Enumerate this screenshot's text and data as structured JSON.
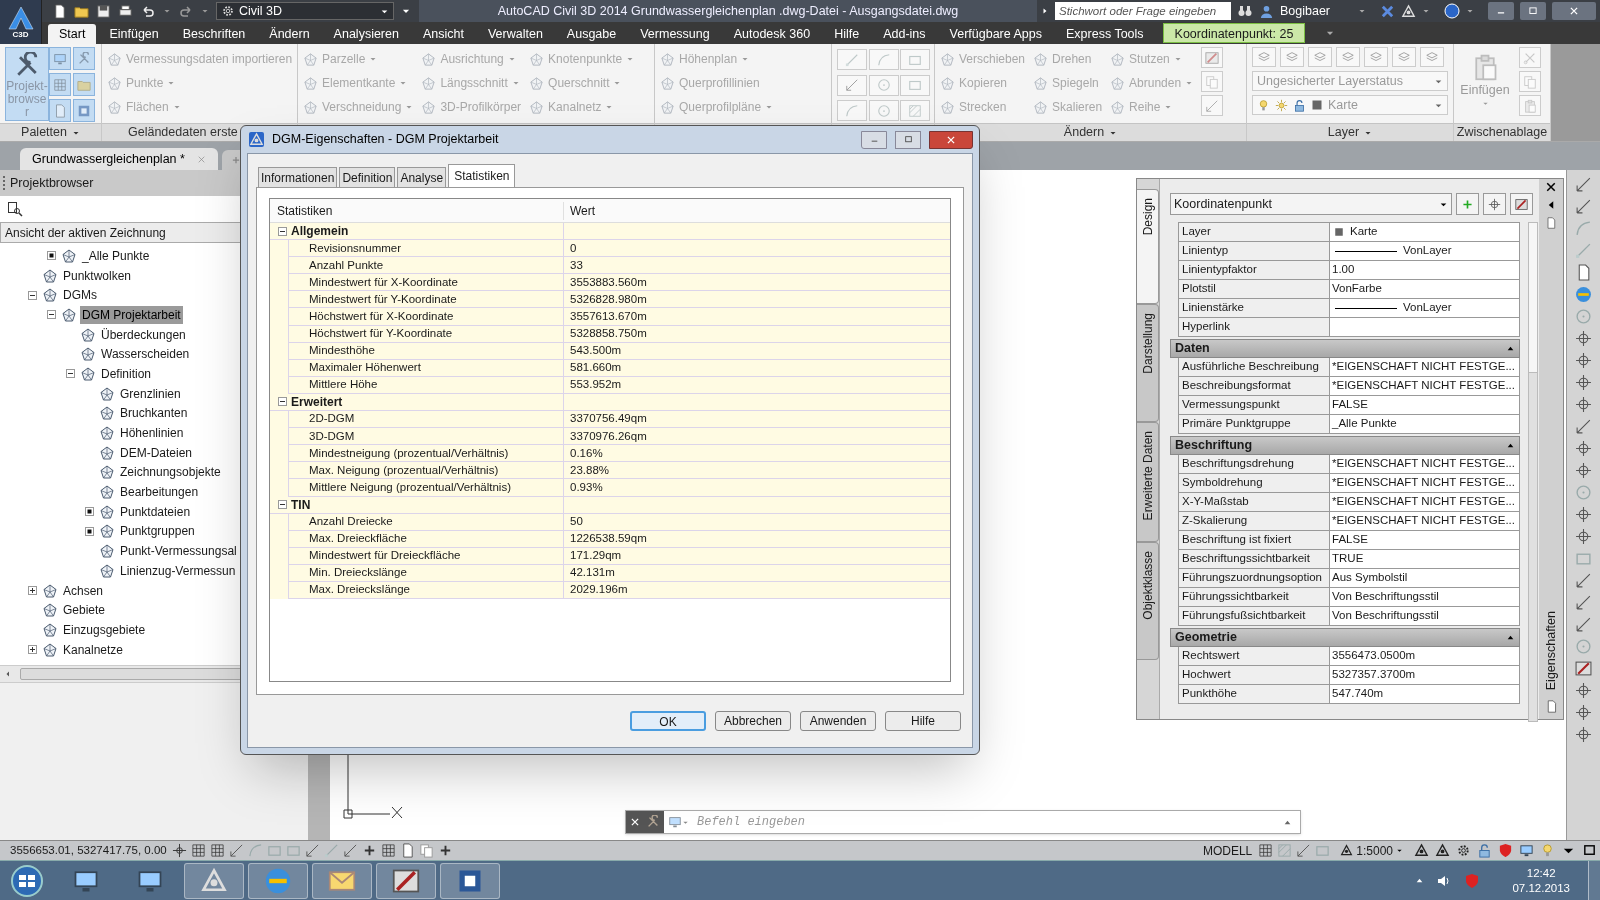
{
  "app_button": {
    "badge": "C3D"
  },
  "title_bar": {
    "workspace": "Civil 3D",
    "title": "AutoCAD Civil 3D 2014   Grundwassergleichenplan .dwg-Datei - Ausgangsdatei.dwg",
    "search_placeholder": "Stichwort oder Frage eingeben",
    "user": "Bogibaer"
  },
  "menu_tabs": [
    {
      "label": "Start",
      "selected": true,
      "kind": "tab"
    },
    {
      "label": "Einfügen",
      "selected": false,
      "kind": "tab"
    },
    {
      "label": "Beschriften",
      "selected": false,
      "kind": "tab"
    },
    {
      "label": "Ändern",
      "selected": false,
      "kind": "tab"
    },
    {
      "label": "Analysieren",
      "selected": false,
      "kind": "tab"
    },
    {
      "label": "Ansicht",
      "selected": false,
      "kind": "tab"
    },
    {
      "label": "Verwalten",
      "selected": false,
      "kind": "tab"
    },
    {
      "label": "Ausgabe",
      "selected": false,
      "kind": "tab"
    },
    {
      "label": "Vermessung",
      "selected": false,
      "kind": "tab"
    },
    {
      "label": "Autodesk 360",
      "selected": false,
      "kind": "tab"
    },
    {
      "label": "Hilfe",
      "selected": false,
      "kind": "tab"
    },
    {
      "label": "Add-ins",
      "selected": false,
      "kind": "tab"
    },
    {
      "label": "Verfügbare Apps",
      "selected": false,
      "kind": "tab"
    },
    {
      "label": "Express Tools",
      "selected": false,
      "kind": "tab"
    },
    {
      "label": "Koordinatenpunkt: 25",
      "selected": false,
      "kind": "contextual"
    }
  ],
  "ribbon": {
    "panels": [
      {
        "kind": "palettes",
        "label": "Paletten",
        "big_button": {
          "label": "Projekt-browser",
          "selected": true
        }
      },
      {
        "kind": "columns",
        "label": "Geländedaten erste",
        "columns": [
          [
            {
              "label": "Vermessungsdaten importieren",
              "dropdown": false,
              "disabled": true
            },
            {
              "label": "Punkte",
              "dropdown": true,
              "disabled": true
            },
            {
              "label": "Flächen",
              "dropdown": true,
              "disabled": true
            }
          ]
        ]
      },
      {
        "kind": "columns",
        "columns": [
          [
            {
              "label": "Parzelle",
              "dropdown": true,
              "disabled": true
            },
            {
              "label": "Elementkante",
              "dropdown": true,
              "disabled": true
            },
            {
              "label": "Verschneidung",
              "dropdown": true,
              "disabled": true
            }
          ],
          [
            {
              "label": "Ausrichtung",
              "dropdown": true,
              "disabled": true
            },
            {
              "label": "Längsschnitt",
              "dropdown": true,
              "disabled": true
            },
            {
              "label": "3D-Profilkörper",
              "dropdown": false,
              "disabled": true
            }
          ],
          [
            {
              "label": "Knotenpunkte",
              "dropdown": true,
              "disabled": true
            },
            {
              "label": "Querschnitt",
              "dropdown": true,
              "disabled": true
            },
            {
              "label": "Kanalnetz",
              "dropdown": true,
              "disabled": true
            }
          ]
        ]
      },
      {
        "kind": "columns",
        "columns": [
          [
            {
              "label": "Höhenplan",
              "dropdown": true,
              "disabled": true
            },
            {
              "label": "Querprofillinien",
              "dropdown": false,
              "disabled": true
            },
            {
              "label": "Querprofilpläne",
              "dropdown": true,
              "disabled": true
            }
          ]
        ]
      },
      {
        "kind": "draw"
      },
      {
        "kind": "columns",
        "label": "Ändern",
        "columns": [
          [
            {
              "label": "Verschieben",
              "dropdown": false,
              "disabled": true
            },
            {
              "label": "Kopieren",
              "dropdown": false,
              "disabled": true
            },
            {
              "label": "Strecken",
              "dropdown": false,
              "disabled": true
            }
          ],
          [
            {
              "label": "Drehen",
              "dropdown": false,
              "disabled": true
            },
            {
              "label": "Spiegeln",
              "dropdown": false,
              "disabled": true
            },
            {
              "label": "Skalieren",
              "dropdown": false,
              "disabled": true
            }
          ],
          [
            {
              "label": "Stutzen",
              "dropdown": true,
              "disabled": true
            },
            {
              "label": "Abrunden",
              "dropdown": true,
              "disabled": true
            },
            {
              "label": "Reihe",
              "dropdown": true,
              "disabled": true
            }
          ]
        ]
      },
      {
        "kind": "layer",
        "label": "Layer",
        "layer_state": "Ungesicherter Layerstatus",
        "current_layer": "Karte"
      },
      {
        "kind": "clipboard",
        "label": "Zwischenablage",
        "big_button": {
          "label": "Einfügen",
          "selected": false
        }
      }
    ]
  },
  "document_tabs": [
    {
      "label": "Grundwassergleichenplan *",
      "selected": true
    }
  ],
  "project_browser": {
    "title": "Projektbrowser",
    "view": "Ansicht der aktiven Zeichnung",
    "orphan_items": [
      {
        "label": "_Alle Punkte",
        "populated": false,
        "selected": false
      }
    ],
    "tree": [
      {
        "label": "Punktwolken",
        "selected": false
      },
      {
        "label": "DGMs",
        "expanded": true,
        "selected": false,
        "children": [
          {
            "label": "DGM Projektarbeit",
            "expanded": true,
            "selected": true,
            "children": [
              {
                "label": "Überdeckungen",
                "selected": false
              },
              {
                "label": "Wasserscheiden",
                "selected": false
              },
              {
                "label": "Definition",
                "expanded": true,
                "selected": false,
                "children": [
                  {
                    "label": "Grenzlinien",
                    "selected": false
                  },
                  {
                    "label": "Bruchkanten",
                    "selected": false
                  },
                  {
                    "label": "Höhenlinien",
                    "selected": false
                  },
                  {
                    "label": "DEM-Dateien",
                    "selected": false
                  },
                  {
                    "label": "Zeichnungsobjekte",
                    "selected": false
                  },
                  {
                    "label": "Bearbeitungen",
                    "selected": false
                  },
                  {
                    "label": "Punktdateien",
                    "populated": false,
                    "selected": false
                  },
                  {
                    "label": "Punktgruppen",
                    "populated": false,
                    "selected": false
                  },
                  {
                    "label": "Punkt-Vermessungsal",
                    "selected": false
                  },
                  {
                    "label": "Linienzug-Vermessun",
                    "selected": false
                  }
                ]
              }
            ]
          }
        ]
      },
      {
        "label": "Achsen",
        "expanded": false,
        "selected": false
      },
      {
        "label": "Gebiete",
        "selected": false
      },
      {
        "label": "Einzugsgebiete",
        "selected": false
      },
      {
        "label": "Kanalnetze",
        "expanded": false,
        "selected": false
      }
    ]
  },
  "dialog": {
    "title": "DGM-Eigenschaften - DGM Projektarbeit",
    "tabs": [
      {
        "label": "Informationen",
        "selected": false
      },
      {
        "label": "Definition",
        "selected": false
      },
      {
        "label": "Analyse",
        "selected": false
      },
      {
        "label": "Statistiken",
        "selected": true
      }
    ],
    "columns": [
      "Statistiken",
      "Wert"
    ],
    "groups": [
      {
        "label": "Allgemein",
        "expanded": true,
        "rows": [
          {
            "name": "Revisionsnummer",
            "value": "0"
          },
          {
            "name": "Anzahl Punkte",
            "value": "33"
          },
          {
            "name": "Mindestwert für X-Koordinate",
            "value": "3553883.560m"
          },
          {
            "name": "Mindestwert für Y-Koordinate",
            "value": "5326828.980m"
          },
          {
            "name": "Höchstwert für X-Koordinate",
            "value": "3557613.670m"
          },
          {
            "name": "Höchstwert für Y-Koordinate",
            "value": "5328858.750m"
          },
          {
            "name": "Mindesthöhe",
            "value": "543.500m"
          },
          {
            "name": "Maximaler Höhenwert",
            "value": "581.660m"
          },
          {
            "name": "Mittlere Höhe",
            "value": "553.952m"
          }
        ]
      },
      {
        "label": "Erweitert",
        "expanded": true,
        "rows": [
          {
            "name": "2D-DGM",
            "value": "3370756.49qm"
          },
          {
            "name": "3D-DGM",
            "value": "3370976.26qm"
          },
          {
            "name": "Mindestneigung (prozentual/Verhältnis)",
            "value": "0.16%"
          },
          {
            "name": "Max. Neigung (prozentual/Verhältnis)",
            "value": "23.88%"
          },
          {
            "name": "Mittlere Neigung (prozentual/Verhältnis)",
            "value": "0.93%"
          }
        ]
      },
      {
        "label": "TIN",
        "expanded": true,
        "rows": [
          {
            "name": "Anzahl Dreiecke",
            "value": "50"
          },
          {
            "name": "Max. Dreieckfläche",
            "value": "1226538.59qm"
          },
          {
            "name": "Mindestwert für Dreieckfläche",
            "value": "171.29qm"
          },
          {
            "name": "Min. Dreieckslänge",
            "value": "42.131m"
          },
          {
            "name": "Max. Dreieckslänge",
            "value": "2029.196m"
          }
        ]
      }
    ],
    "buttons": [
      {
        "label": "OK",
        "default": true
      },
      {
        "label": "Abbrechen",
        "default": false
      },
      {
        "label": "Anwenden",
        "default": false
      },
      {
        "label": "Hilfe",
        "default": false
      }
    ]
  },
  "properties": {
    "title": "Eigenschaften",
    "object_type": "Koordinatenpunkt",
    "side_tabs": [
      {
        "label": "Design",
        "selected": true
      },
      {
        "label": "Darstellung",
        "selected": false
      },
      {
        "label": "Erweiterte Daten",
        "selected": false
      },
      {
        "label": "Objektklasse",
        "selected": false
      }
    ],
    "general_rows": [
      {
        "name": "Layer",
        "value": "Karte",
        "kind": "layer"
      },
      {
        "name": "Linientyp",
        "value": "VonLayer",
        "kind": "line"
      },
      {
        "name": "Linientypfaktor",
        "value": "1.00",
        "kind": "text"
      },
      {
        "name": "Plotstil",
        "value": "VonFarbe",
        "kind": "text"
      },
      {
        "name": "Linienstärke",
        "value": "VonLayer",
        "kind": "line"
      },
      {
        "name": "Hyperlink",
        "kind": "text"
      }
    ],
    "sections": [
      {
        "label": "Daten",
        "expanded": true,
        "rows": [
          {
            "name": "Ausführliche Beschreibung",
            "value": "*EIGENSCHAFT NICHT FESTGE..."
          },
          {
            "name": "Beschreibungsformat",
            "value": "*EIGENSCHAFT NICHT FESTGE..."
          },
          {
            "name": "Vermessungspunkt",
            "value": "FALSE"
          },
          {
            "name": "Primäre Punktgruppe",
            "value": "_Alle Punkte"
          }
        ]
      },
      {
        "label": "Beschriftung",
        "expanded": true,
        "rows": [
          {
            "name": "Beschriftungsdrehung",
            "value": "*EIGENSCHAFT NICHT FESTGE..."
          },
          {
            "name": "Symboldrehung",
            "value": "*EIGENSCHAFT NICHT FESTGE..."
          },
          {
            "name": "X-Y-Maßstab",
            "value": "*EIGENSCHAFT NICHT FESTGE..."
          },
          {
            "name": "Z-Skalierung",
            "value": "*EIGENSCHAFT NICHT FESTGE..."
          },
          {
            "name": "Beschriftung ist fixiert",
            "value": "FALSE"
          },
          {
            "name": "Beschriftungssichtbarkeit",
            "value": "TRUE"
          },
          {
            "name": "Führungszuordnungsoption",
            "value": "Aus Symbolstil"
          },
          {
            "name": "Führungssichtbarkeit",
            "value": "Von Beschriftungsstil"
          },
          {
            "name": "Führungsfußsichtbarkeit",
            "value": "Von Beschriftungsstil"
          }
        ]
      },
      {
        "label": "Geometrie",
        "expanded": true,
        "rows": [
          {
            "name": "Rechtswert",
            "value": "3556473.0500m"
          },
          {
            "name": "Hochwert",
            "value": "5327357.3700m"
          },
          {
            "name": "Punkthöhe",
            "value": "547.740m"
          }
        ]
      }
    ]
  },
  "command_line": {
    "placeholder": "Befehl eingeben"
  },
  "status_bar": {
    "coordinates": "3556653.01, 5327417.75, 0.00",
    "space": "MODELL",
    "scale": "1:5000"
  },
  "taskbar": {
    "time": "12:42",
    "date": "07.12.2013"
  }
}
